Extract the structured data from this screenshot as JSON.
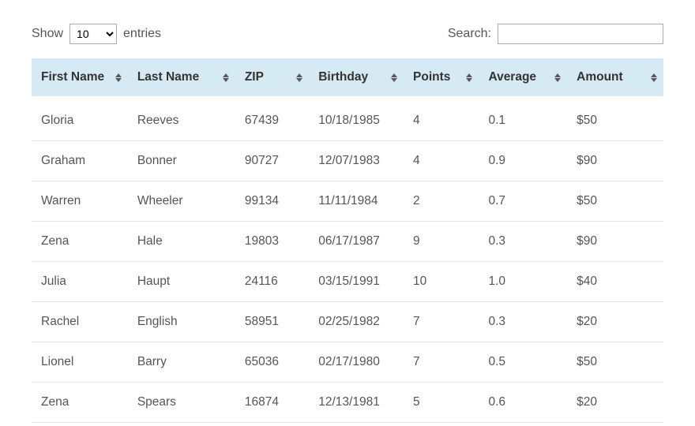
{
  "length": {
    "show_label": "Show",
    "entries_label": "entries",
    "selected": "10",
    "options": [
      "10",
      "25",
      "50",
      "100"
    ]
  },
  "search": {
    "label": "Search:",
    "value": ""
  },
  "columns": {
    "first_name": "First Name",
    "last_name": "Last Name",
    "zip": "ZIP",
    "birthday": "Birthday",
    "points": "Points",
    "average": "Average",
    "amount": "Amount"
  },
  "rows": [
    {
      "first_name": "Gloria",
      "last_name": "Reeves",
      "zip": "67439",
      "birthday": "10/18/1985",
      "points": "4",
      "average": "0.1",
      "amount": "$50"
    },
    {
      "first_name": "Graham",
      "last_name": "Bonner",
      "zip": "90727",
      "birthday": "12/07/1983",
      "points": "4",
      "average": "0.9",
      "amount": "$90"
    },
    {
      "first_name": "Warren",
      "last_name": "Wheeler",
      "zip": "99134",
      "birthday": "11/11/1984",
      "points": "2",
      "average": "0.7",
      "amount": "$50"
    },
    {
      "first_name": "Zena",
      "last_name": "Hale",
      "zip": "19803",
      "birthday": "06/17/1987",
      "points": "9",
      "average": "0.3",
      "amount": "$90"
    },
    {
      "first_name": "Julia",
      "last_name": "Haupt",
      "zip": "24116",
      "birthday": "03/15/1991",
      "points": "10",
      "average": "1.0",
      "amount": "$40"
    },
    {
      "first_name": "Rachel",
      "last_name": "English",
      "zip": "58951",
      "birthday": "02/25/1982",
      "points": "7",
      "average": "0.3",
      "amount": "$20"
    },
    {
      "first_name": "Lionel",
      "last_name": "Barry",
      "zip": "65036",
      "birthday": "02/17/1980",
      "points": "7",
      "average": "0.5",
      "amount": "$50"
    },
    {
      "first_name": "Zena",
      "last_name": "Spears",
      "zip": "16874",
      "birthday": "12/13/1981",
      "points": "5",
      "average": "0.6",
      "amount": "$20"
    }
  ]
}
